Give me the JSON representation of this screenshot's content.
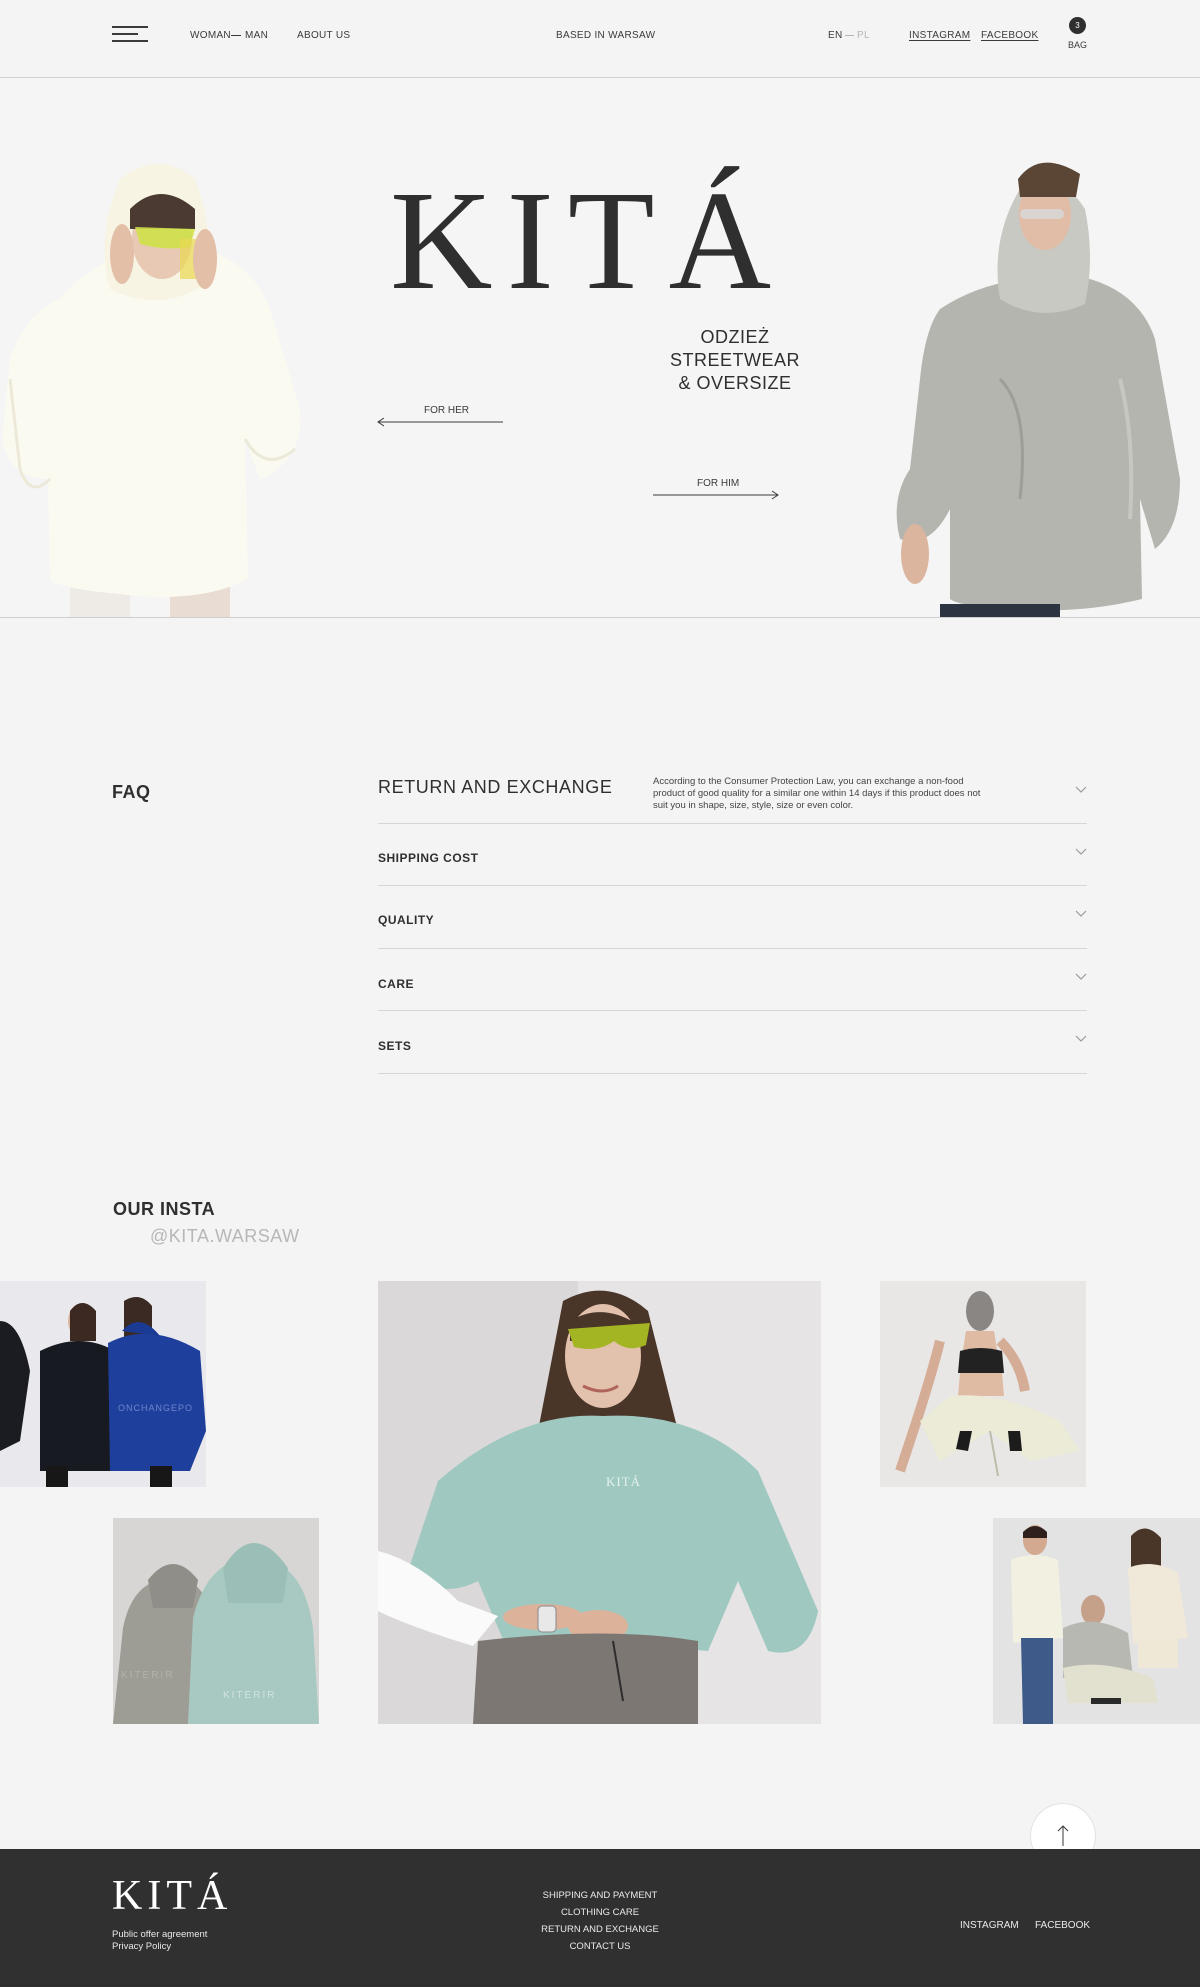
{
  "header": {
    "nav_woman": "WOMAN",
    "nav_man": "MAN",
    "nav_about": "ABOUT US",
    "location": "BASED IN WARSAW",
    "lang_en": "EN",
    "lang_pl": "PL",
    "instagram": "INSTAGRAM",
    "facebook": "FACEBOOK",
    "bag_count": "3",
    "bag_label": "BAG"
  },
  "hero": {
    "brand": "KITÁ",
    "tagline_1": "ODZIEŻ",
    "tagline_2": "STREETWEAR",
    "tagline_3": "& OVERSIZE",
    "for_her": "FOR HER",
    "for_him": "FOR HIM"
  },
  "faq": {
    "title": "FAQ",
    "items": [
      {
        "question": "RETURN AND EXCHANGE",
        "answer": "According to the Consumer Protection Law, you can exchange a non-food product of good quality for a similar one within 14 days if this product does not suit you in shape, size, style, size or even color."
      },
      {
        "question": "SHIPPING COST"
      },
      {
        "question": "QUALITY"
      },
      {
        "question": "CARE"
      },
      {
        "question": "SETS"
      }
    ]
  },
  "insta": {
    "title": "OUR INSTA",
    "handle": "@KITA.WARSAW"
  },
  "footer": {
    "brand": "KITÁ",
    "offer": "Public offer agreement",
    "privacy": "Privacy Policy",
    "links": [
      "SHIPPING AND PAYMENT",
      "CLOTHING CARE",
      "RETURN AND EXCHANGE",
      "CONTACT US"
    ],
    "instagram": "INSTAGRAM",
    "facebook": "FACEBOOK"
  },
  "colors": {
    "background": "#f4f4f4",
    "text": "#2c2c2c",
    "footer_bg": "#303030",
    "muted": "#b7b7b7"
  }
}
